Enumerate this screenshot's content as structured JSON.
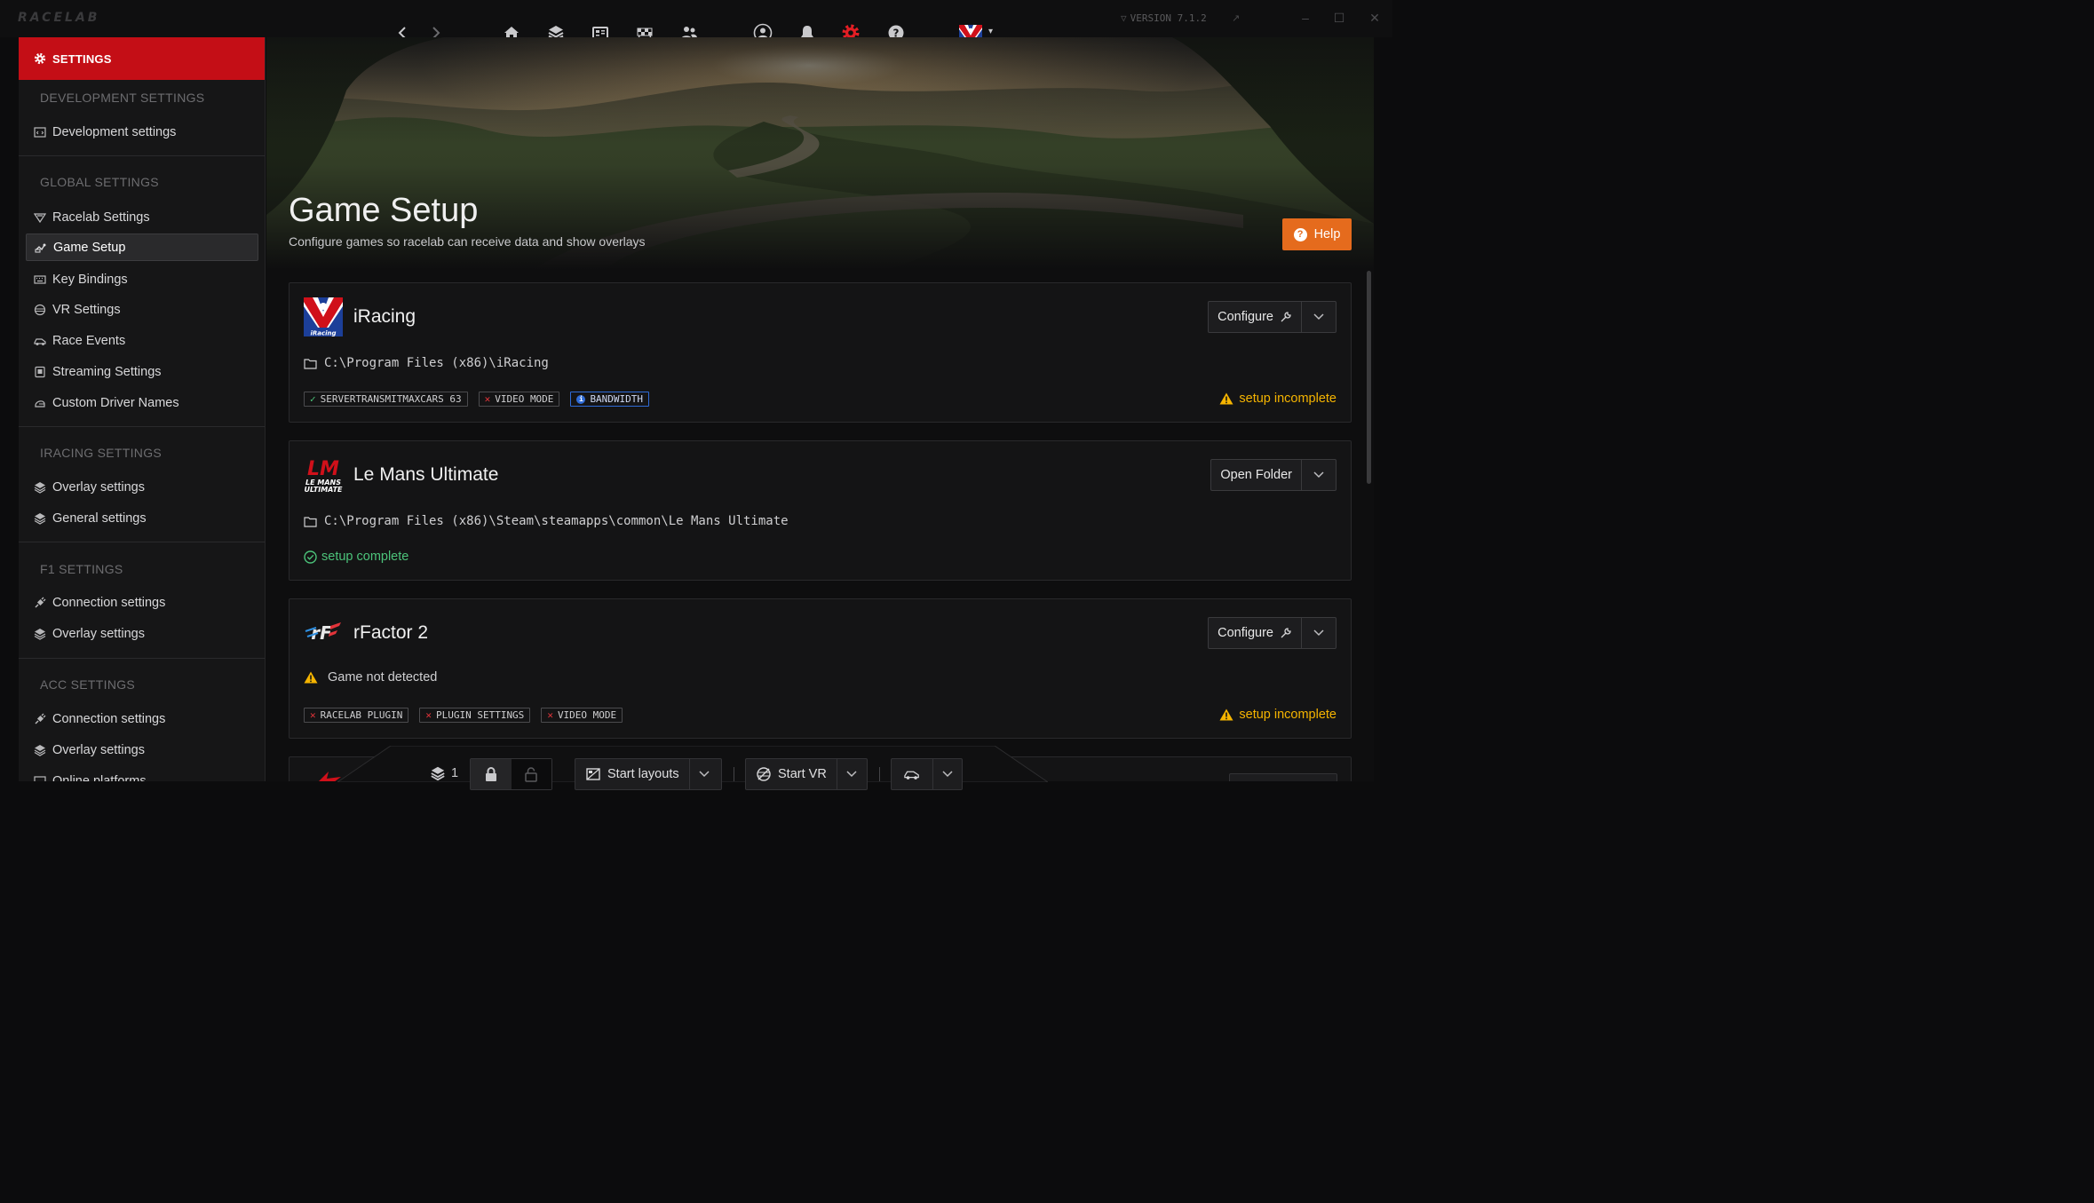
{
  "app": {
    "logo_text": "RACELAB",
    "version": "VERSION 7.1.2"
  },
  "sidebar": {
    "header": "SETTINGS",
    "sections": [
      {
        "title": "DEVELOPMENT SETTINGS",
        "items": [
          "Development settings"
        ]
      },
      {
        "title": "GLOBAL SETTINGS",
        "items": [
          "Racelab Settings",
          "Game Setup",
          "Key Bindings",
          "VR Settings",
          "Race Events",
          "Streaming Settings",
          "Custom Driver Names"
        ]
      },
      {
        "title": "IRACING SETTINGS",
        "items": [
          "Overlay settings",
          "General settings"
        ]
      },
      {
        "title": "F1 SETTINGS",
        "items": [
          "Connection settings",
          "Overlay settings"
        ]
      },
      {
        "title": "ACC SETTINGS",
        "items": [
          "Connection settings",
          "Overlay settings",
          "Online platforms"
        ]
      }
    ],
    "active_item": "Game Setup"
  },
  "page": {
    "title": "Game Setup",
    "subtitle": "Configure games so racelab can receive data and show overlays",
    "help_label": "Help"
  },
  "games": [
    {
      "name": "iRacing",
      "path": "C:\\Program Files (x86)\\iRacing",
      "action": "Configure",
      "tags": [
        {
          "label": "SERVERTRANSMITMAXCARS 63",
          "state": "ok"
        },
        {
          "label": "VIDEO MODE",
          "state": "err"
        },
        {
          "label": "BANDWIDTH",
          "state": "info"
        }
      ],
      "status": "setup incomplete"
    },
    {
      "name": "Le Mans Ultimate",
      "path": "C:\\Program Files (x86)\\Steam\\steamapps\\common\\Le Mans Ultimate",
      "action": "Open Folder",
      "status": "setup complete"
    },
    {
      "name": "rFactor 2",
      "detected": "Game not detected",
      "action": "Configure",
      "tags": [
        {
          "label": "RACELAB PLUGIN",
          "state": "err"
        },
        {
          "label": "PLUGIN SETTINGS",
          "state": "err"
        },
        {
          "label": "VIDEO MODE",
          "state": "err"
        }
      ],
      "status": "setup incomplete"
    }
  ],
  "bottom_bar": {
    "layers_count": "1",
    "start_layouts": "Start layouts",
    "start_vr": "Start VR"
  },
  "colors": {
    "accent": "#c40e16",
    "warning": "#f5b400",
    "success": "#4cc37a",
    "help": "#e56b1d"
  }
}
